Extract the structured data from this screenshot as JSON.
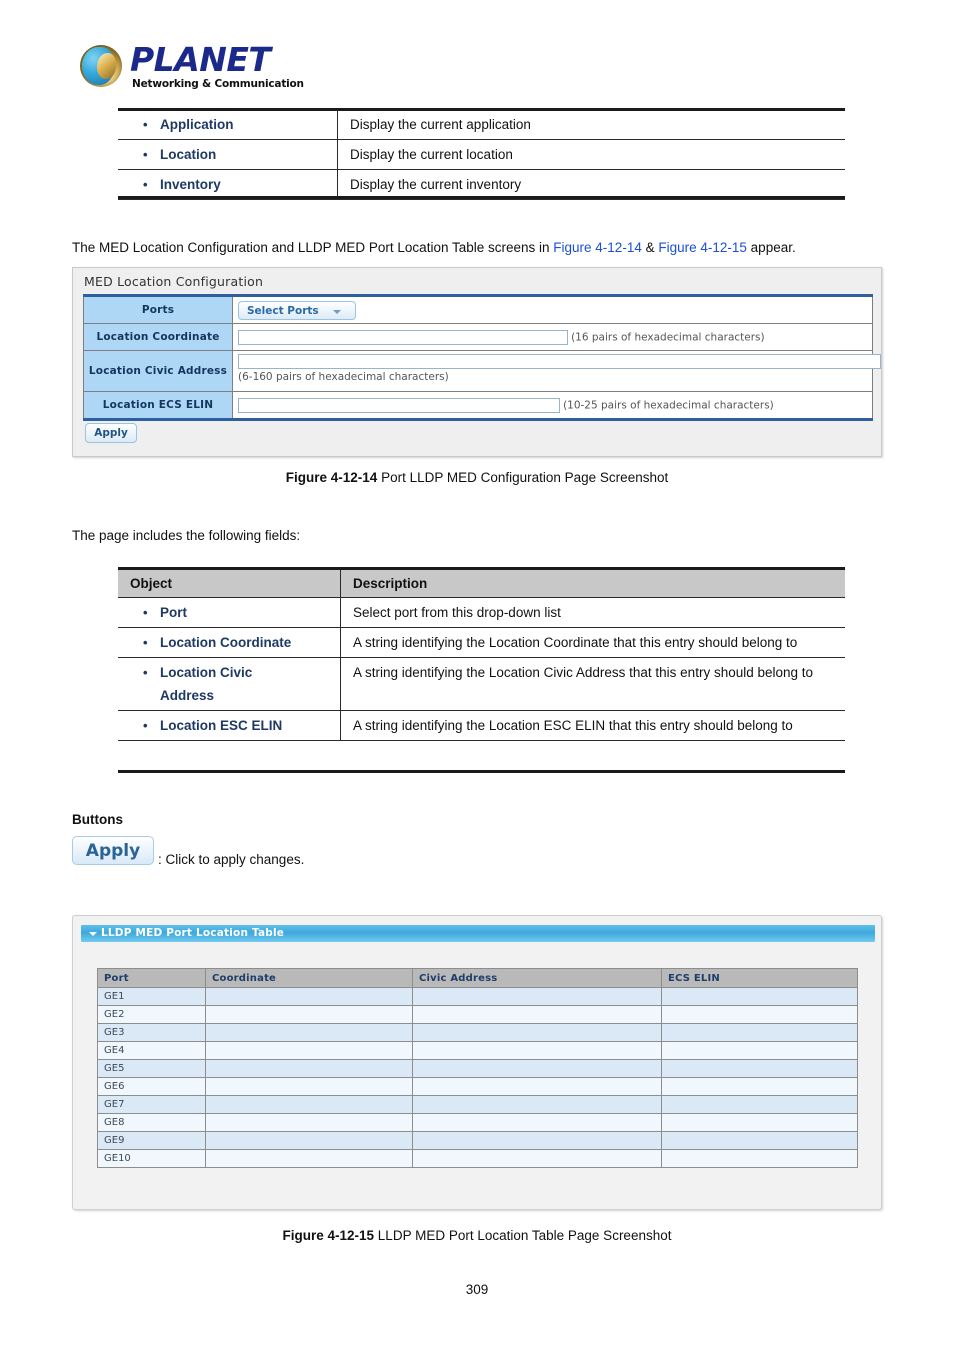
{
  "brand": {
    "name": "PLANET",
    "tagline": "Networking & Communication",
    "logo_icon": "planet-globe-icon",
    "name_color": "#1b2a8a"
  },
  "top_table": {
    "rows": [
      {
        "object": "Application",
        "description": "Display the current application"
      },
      {
        "object": "Location",
        "description": "Display the current location"
      },
      {
        "object": "Inventory",
        "description": "Display the current inventory"
      }
    ]
  },
  "intro_paragraph": {
    "part1": "The MED Location Configuration and LLDP MED Port Location Table screens in ",
    "link1": "Figure 4-12-14",
    "joiner": " & ",
    "link2": "Figure 4-12-15",
    "part2": " appear.",
    "link_color": "#1b4fd8"
  },
  "med_panel": {
    "title": "MED Location Configuration",
    "rows": [
      {
        "label": "Ports",
        "control": "select",
        "value": "Select Ports",
        "hint": ""
      },
      {
        "label": "Location Coordinate",
        "control": "text",
        "value": "",
        "hint": "(16 pairs of hexadecimal characters)"
      },
      {
        "label": "Location Civic Address",
        "control": "text-wide",
        "value": "",
        "hint": "(6-160 pairs of hexadecimal characters)"
      },
      {
        "label": "Location ECS ELIN",
        "control": "text",
        "value": "",
        "hint": "(10-25 pairs of hexadecimal characters)"
      }
    ],
    "apply_label": "Apply",
    "label_bg": "#aed6f5",
    "border_accent": "#2e5f9e",
    "caret_icon": "chevron-down-icon"
  },
  "figure_14": {
    "number": "Figure 4-12-14",
    "caption": " Port LLDP MED Configuration Page Screenshot"
  },
  "fields_intro": "The page includes the following fields:",
  "object_table": {
    "headers": {
      "object": "Object",
      "description": "Description"
    },
    "rows": [
      {
        "object": "Port",
        "object2": "",
        "description": "Select port from this drop-down list"
      },
      {
        "object": "Location Coordinate",
        "object2": "",
        "description": "A string identifying the Location Coordinate that this entry should belong to"
      },
      {
        "object": "Location Civic",
        "object2": "Address",
        "description": "A string identifying the Location Civic Address that this entry should belong to"
      },
      {
        "object": "Location ESC ELIN",
        "object2": "",
        "description": "A string identifying the Location ESC ELIN that this entry should belong to"
      }
    ],
    "header_bg": "#c8c8c8"
  },
  "buttons_section": {
    "heading": "Buttons",
    "apply_label": "Apply",
    "apply_description": ": Click to apply changes."
  },
  "lldp_panel": {
    "title": "LLDP MED Port Location Table",
    "collapse_icon": "caret-down-icon",
    "title_bar_color": "#3ea8dd",
    "headers": [
      "Port",
      "Coordinate",
      "Civic Address",
      "ECS ELIN"
    ],
    "rows": [
      {
        "port": "GE1",
        "coordinate": "",
        "civic_address": "",
        "ecs_elin": ""
      },
      {
        "port": "GE2",
        "coordinate": "",
        "civic_address": "",
        "ecs_elin": ""
      },
      {
        "port": "GE3",
        "coordinate": "",
        "civic_address": "",
        "ecs_elin": ""
      },
      {
        "port": "GE4",
        "coordinate": "",
        "civic_address": "",
        "ecs_elin": ""
      },
      {
        "port": "GE5",
        "coordinate": "",
        "civic_address": "",
        "ecs_elin": ""
      },
      {
        "port": "GE6",
        "coordinate": "",
        "civic_address": "",
        "ecs_elin": ""
      },
      {
        "port": "GE7",
        "coordinate": "",
        "civic_address": "",
        "ecs_elin": ""
      },
      {
        "port": "GE8",
        "coordinate": "",
        "civic_address": "",
        "ecs_elin": ""
      },
      {
        "port": "GE9",
        "coordinate": "",
        "civic_address": "",
        "ecs_elin": ""
      },
      {
        "port": "GE10",
        "coordinate": "",
        "civic_address": "",
        "ecs_elin": ""
      }
    ]
  },
  "figure_15": {
    "number": "Figure 4-12-15",
    "caption": " LLDP MED Port Location Table Page Screenshot"
  },
  "page_number": "309"
}
